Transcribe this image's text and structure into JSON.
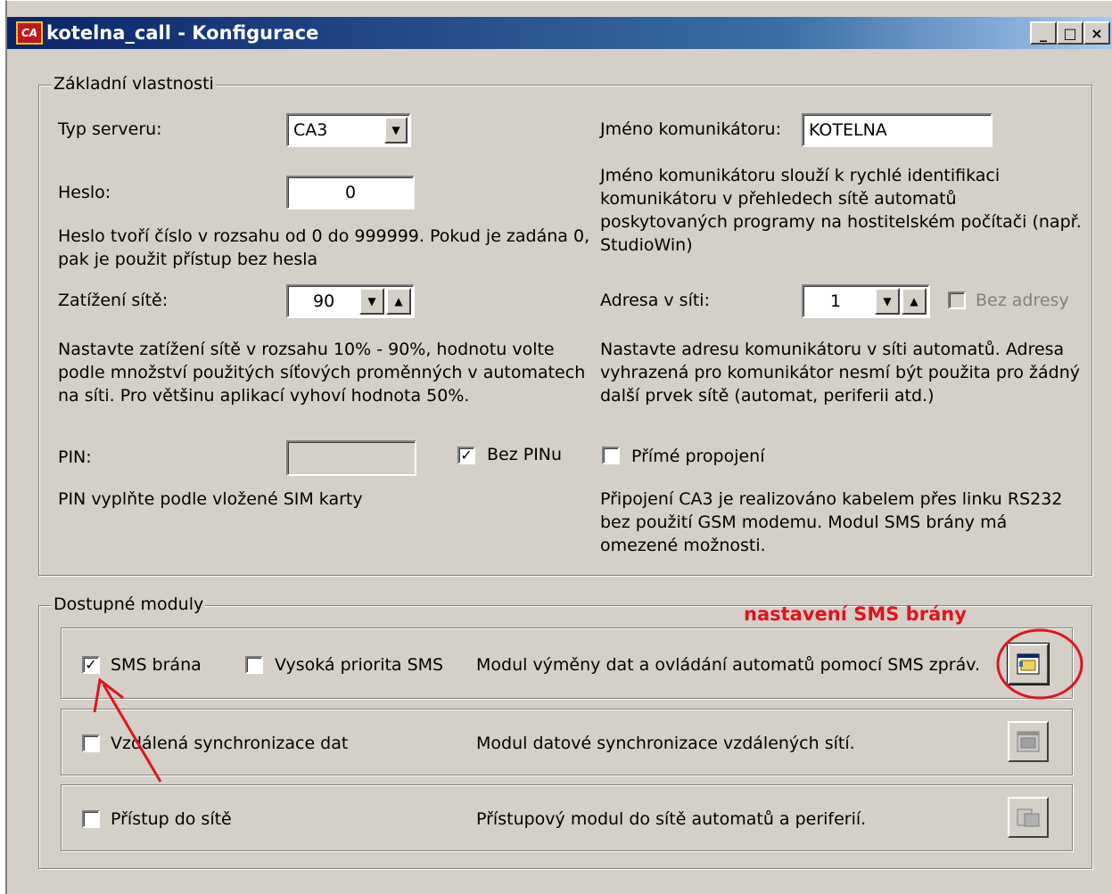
{
  "window": {
    "title": "kotelna_call - Konfigurace",
    "icon_text": "CA",
    "buttons": {
      "minimize": "_",
      "maximize": "□",
      "close": "×"
    }
  },
  "basic": {
    "legend": "Základní vlastnosti",
    "server_type_label": "Typ serveru:",
    "server_type_value": "CA3",
    "password_label": "Heslo:",
    "password_value": "0",
    "password_note": "Heslo tvoří číslo v rozsahu od 0 do 999999. Pokud je zadána 0, pak je použit přístup bez hesla",
    "comm_name_label": "Jméno komunikátoru:",
    "comm_name_value": "KOTELNA",
    "comm_name_note": "Jméno komunikátoru slouží k rychlé identifikaci komunikátoru v přehledech sítě automatů poskytovaných programy na hostitelském počítači (např. StudioWin)",
    "load_label": "Zatížení sítě:",
    "load_value": "90",
    "load_note": "Nastavte zatížení sítě v rozsahu 10% - 90%, hodnotu volte podle množství použitých síťových proměnných v automatech na síti. Pro většinu aplikací vyhoví hodnota 50%.",
    "address_label": "Adresa v síti:",
    "address_value": "1",
    "no_address_label": "Bez adresy",
    "address_note": "Nastavte adresu komunikátoru v síti automatů. Adresa vyhrazená pro komunikátor nesmí být použita pro žádný další prvek sítě (automat, periferii atd.)",
    "pin_label": "PIN:",
    "pin_value": "",
    "no_pin_label": "Bez PINu",
    "no_pin_checked": true,
    "pin_note": "PIN vyplňte podle vložené SIM karty",
    "direct_label": "Přímé propojení",
    "direct_checked": false,
    "direct_note": "Připojení CA3 je realizováno kabelem přes linku RS232 bez použití GSM modemu. Modul SMS brány má omezené možnosti."
  },
  "modules": {
    "legend": "Dostupné moduly",
    "annotation": "nastavení SMS brány",
    "items": [
      {
        "label": "SMS brána",
        "checked": true,
        "extra_label": "Vysoká priorita SMS",
        "description": "Modul výměny dat a ovládání automatů pomocí SMS zpráv."
      },
      {
        "label": "Vzdálená synchronizace dat",
        "checked": false,
        "description": "Modul datové synchronizace vzdálených sítí."
      },
      {
        "label": "Přístup do sítě",
        "checked": false,
        "description": "Přístupový modul do sítě automatů a periferií."
      }
    ]
  }
}
